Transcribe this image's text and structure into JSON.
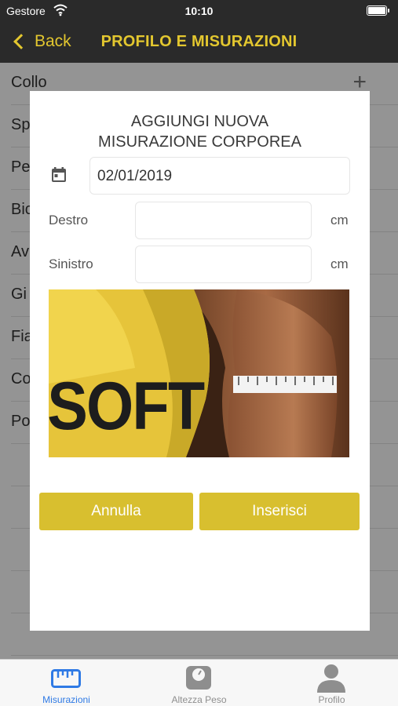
{
  "status_bar": {
    "carrier": "Gestore",
    "time": "10:10",
    "wifi_icon": "wifi-icon",
    "battery_icon": "battery-icon"
  },
  "nav": {
    "back_label": "Back",
    "title": "PROFILO E MISURAZIONI"
  },
  "list": {
    "items": [
      "Collo",
      "Sp",
      "Pe",
      "Bic",
      "Av",
      "Gi",
      "Fia",
      "Co",
      "Po"
    ]
  },
  "dialog": {
    "title_line1": "AGGIUNGI NUOVA",
    "title_line2": "MISURAZIONE CORPOREA",
    "date_value": "02/01/2019",
    "right_label": "Destro",
    "left_label": "Sinistro",
    "unit": "cm",
    "shirt_text": "SOFT",
    "cancel_label": "Annulla",
    "insert_label": "Inserisci"
  },
  "tabs": [
    {
      "label": "Misurazioni",
      "icon": "ruler-icon",
      "active": true
    },
    {
      "label": "Altezza Peso",
      "icon": "scale-icon",
      "active": false
    },
    {
      "label": "Profilo",
      "icon": "person-icon",
      "active": false
    }
  ],
  "colors": {
    "accent": "#e3c72f",
    "button": "#d8bf2f",
    "nav_bg": "#2a2a2a",
    "tab_active": "#2f7ae5"
  }
}
